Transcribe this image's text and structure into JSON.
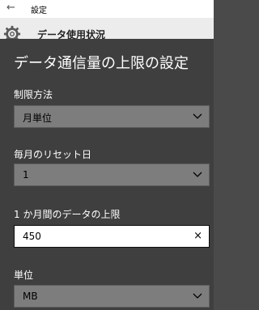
{
  "window": {
    "back_glyph": "←",
    "title": "設定"
  },
  "background_page": {
    "icon": "gear-icon",
    "header": "データ使用状況"
  },
  "dialog": {
    "title": "データ通信量の上限の設定",
    "limit_method": {
      "label": "制限方法",
      "value": "月単位"
    },
    "reset_day": {
      "label": "毎月のリセット日",
      "value": "1"
    },
    "monthly_limit": {
      "label": "1 か月間のデータの上限",
      "value": "450",
      "clear_glyph": "×"
    },
    "unit": {
      "label": "単位",
      "value": "MB"
    }
  }
}
